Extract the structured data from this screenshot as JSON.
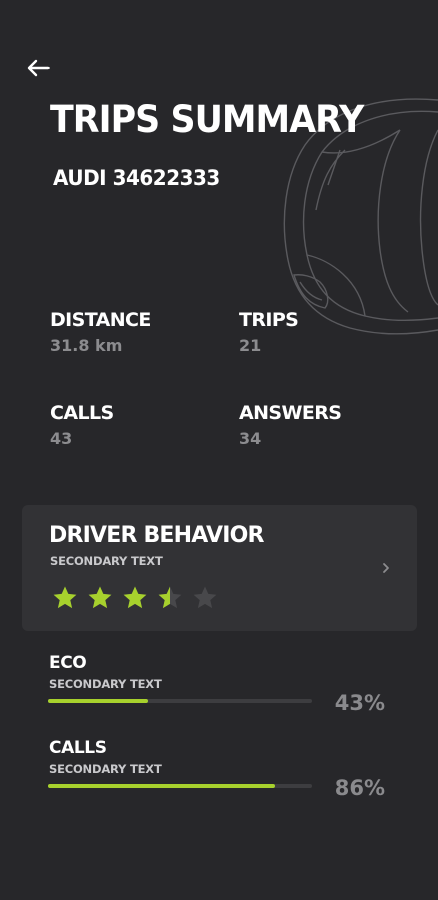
{
  "header": {
    "back_icon": "arrow-left-icon",
    "title": "TRIPS SUMMARY",
    "vehicle": "AUDI 34622333"
  },
  "stats": {
    "distance": {
      "label": "DISTANCE",
      "value": "31.8 km"
    },
    "trips": {
      "label": "TRIPS",
      "value": "21"
    },
    "calls": {
      "label": "CALLS",
      "value": "43"
    },
    "answers": {
      "label": "ANSWERS",
      "value": "34"
    }
  },
  "driver_behavior": {
    "title": "DRIVER BEHAVIOR",
    "secondary": "SECONDARY TEXT",
    "rating": 3.5,
    "max_rating": 5
  },
  "metrics": [
    {
      "label": "ECO",
      "secondary": "SECONDARY TEXT",
      "percent": "43%",
      "fraction": 0.38
    },
    {
      "label": "CALLS",
      "secondary": "SECONDARY TEXT",
      "percent": "86%",
      "fraction": 0.86
    }
  ],
  "colors": {
    "background": "#27272a",
    "card": "#323235",
    "accent": "#a7d12d",
    "muted": "#8c8c8f"
  }
}
